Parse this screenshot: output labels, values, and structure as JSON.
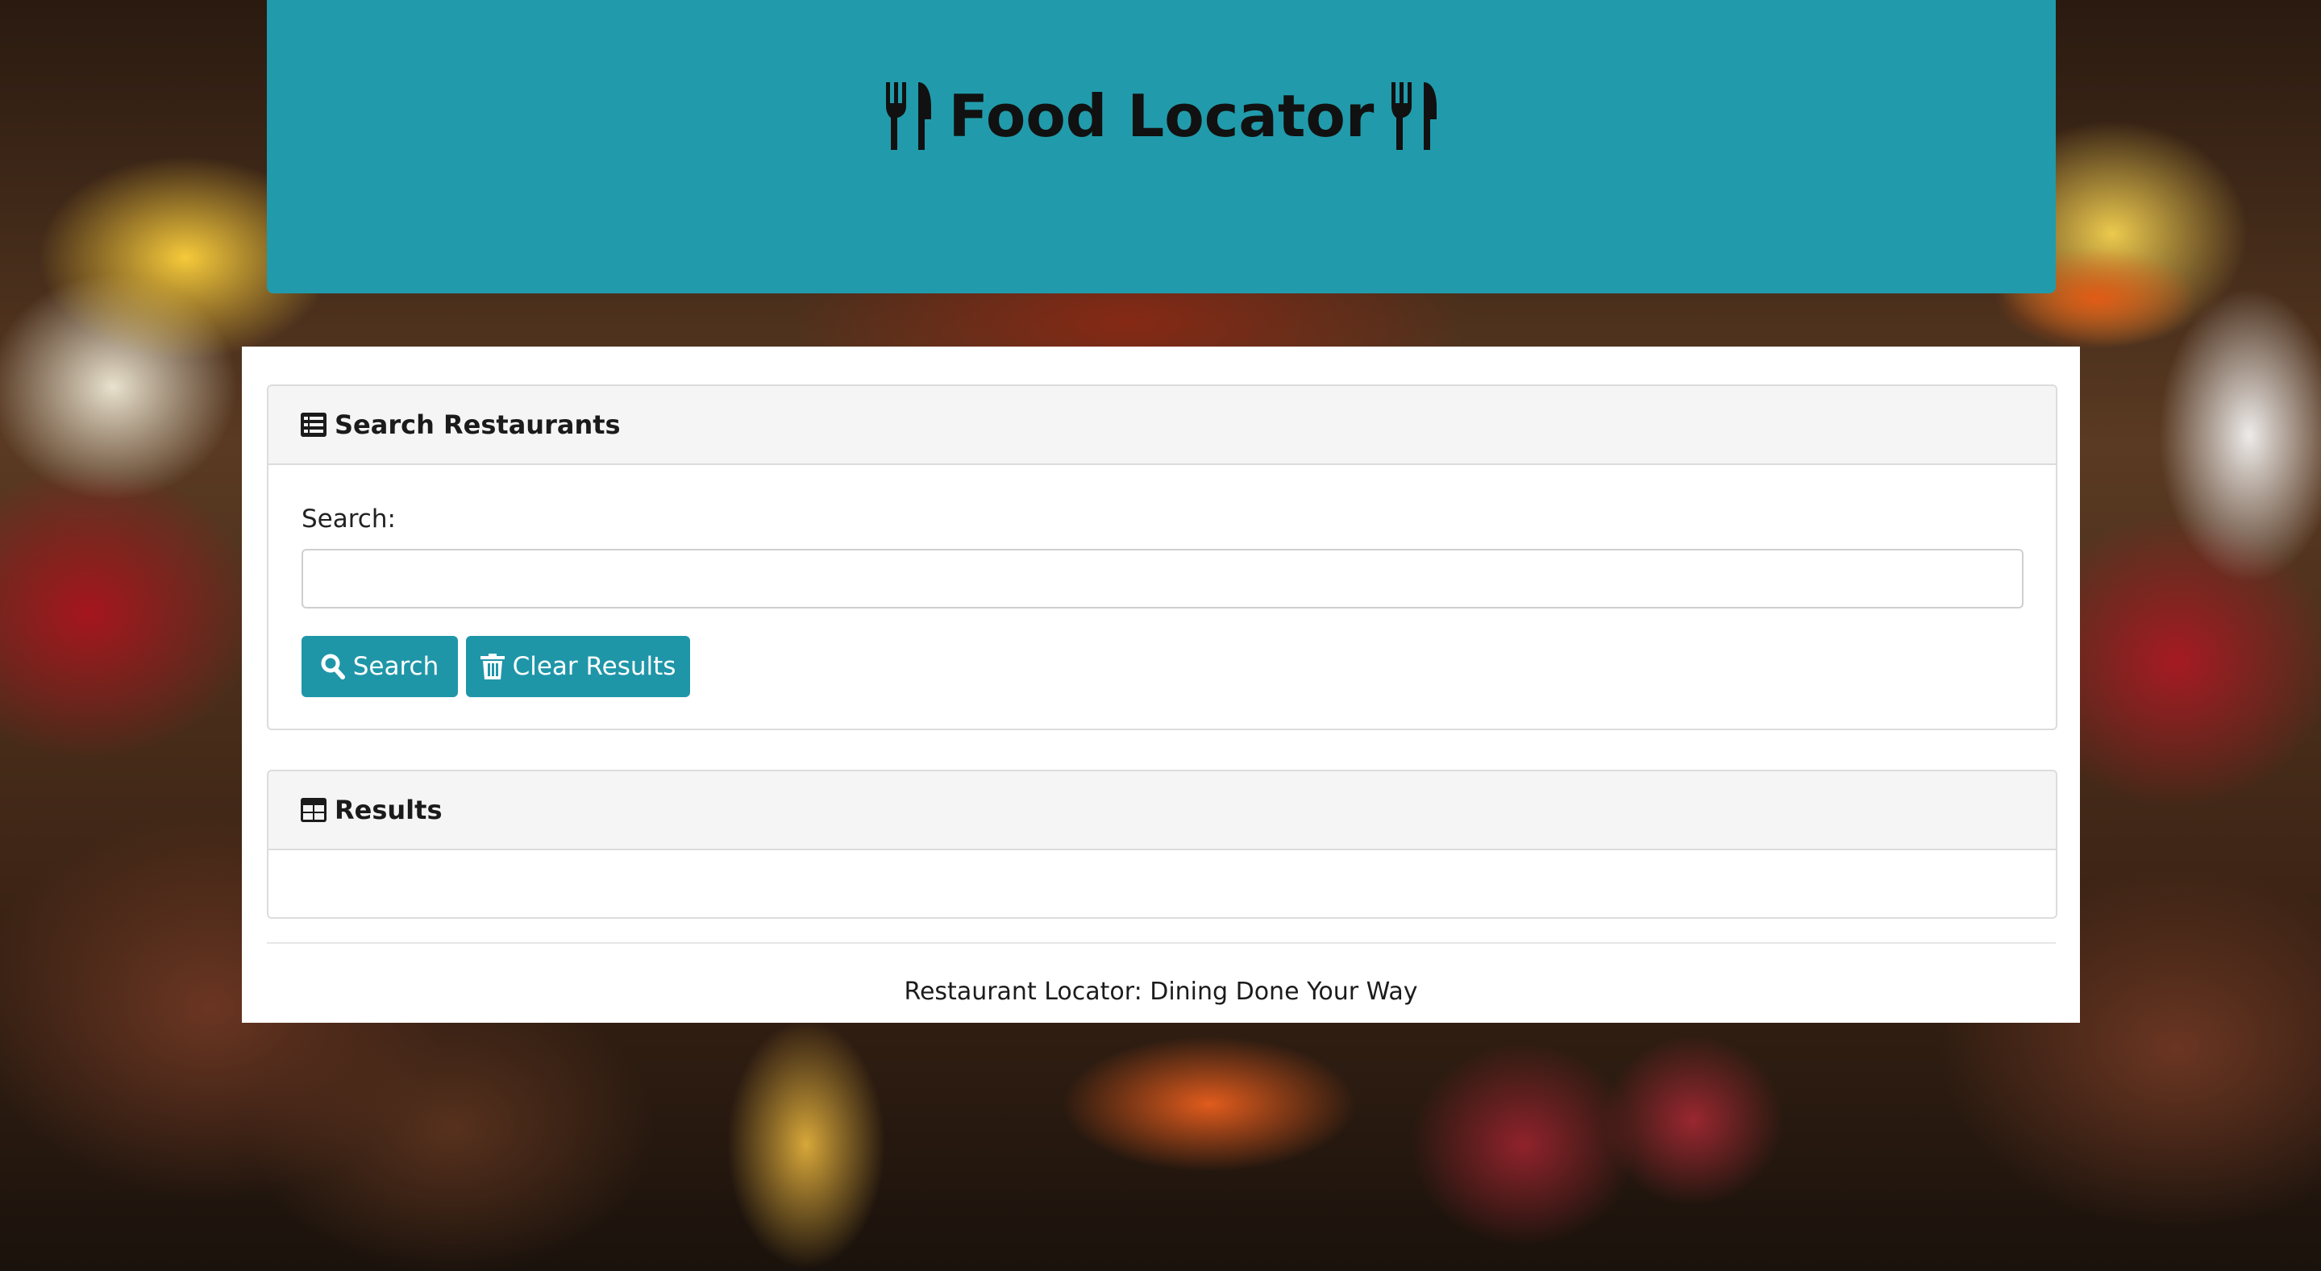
{
  "header": {
    "title": "Food Locator",
    "icon_left": "utensils-icon",
    "icon_right": "utensils-icon"
  },
  "search_card": {
    "title": "Search Restaurants",
    "icon": "list-icon",
    "label": "Search:",
    "input_value": "",
    "input_placeholder": "",
    "search_button": "Search",
    "search_button_icon": "search-icon",
    "clear_button": "Clear Results",
    "clear_button_icon": "trash-icon"
  },
  "results_card": {
    "title": "Results",
    "icon": "table-icon"
  },
  "footer": {
    "text": "Restaurant Locator: Dining Done Your Way"
  },
  "colors": {
    "header_bg": "#219bab",
    "button_bg": "#1f96a8"
  }
}
